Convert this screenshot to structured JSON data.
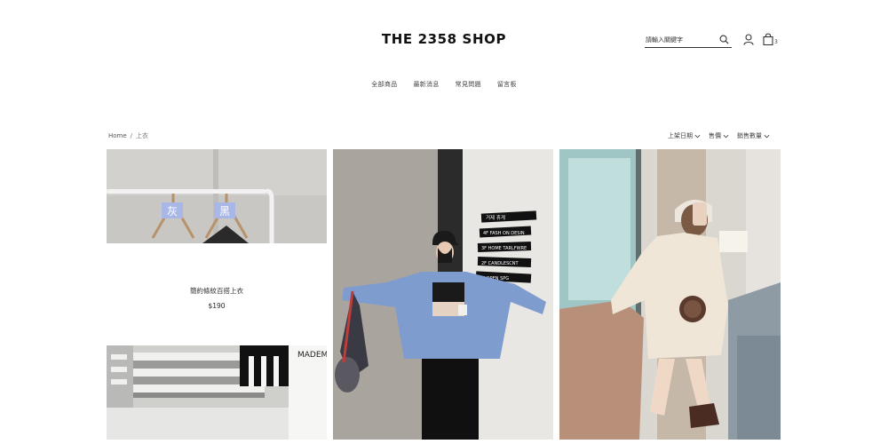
{
  "header": {
    "title": "THE 2358 SHOP",
    "search_placeholder": "請輸入關鍵字",
    "cart_count": "3"
  },
  "nav": {
    "items": [
      {
        "label": "全部商品"
      },
      {
        "label": "最新消息"
      },
      {
        "label": "常見問題"
      },
      {
        "label": "留言板"
      }
    ]
  },
  "breadcrumb": {
    "home": "Home",
    "separator": "/",
    "current": "上衣"
  },
  "sort": {
    "options": [
      {
        "label": "上架日期"
      },
      {
        "label": "售價"
      },
      {
        "label": "銷售數量"
      }
    ]
  },
  "products": {
    "featured": {
      "name": "簡約條紋百搭上衣",
      "price": "$190",
      "hanger_tags": [
        "灰",
        "黑"
      ]
    },
    "store_sign": [
      "거제 휴게",
      "4F FASH ON DESIN",
      "3F HOME TARLFWRE",
      "2F CANDLESCNT",
      "1F OPEN SPG"
    ],
    "bottom_tile_text": "MADEM"
  },
  "colors": {
    "text": "#333333",
    "tag_blue": "#a9b7e6",
    "denim": "#7f9ccf",
    "cream_knit": "#efe6d8"
  }
}
